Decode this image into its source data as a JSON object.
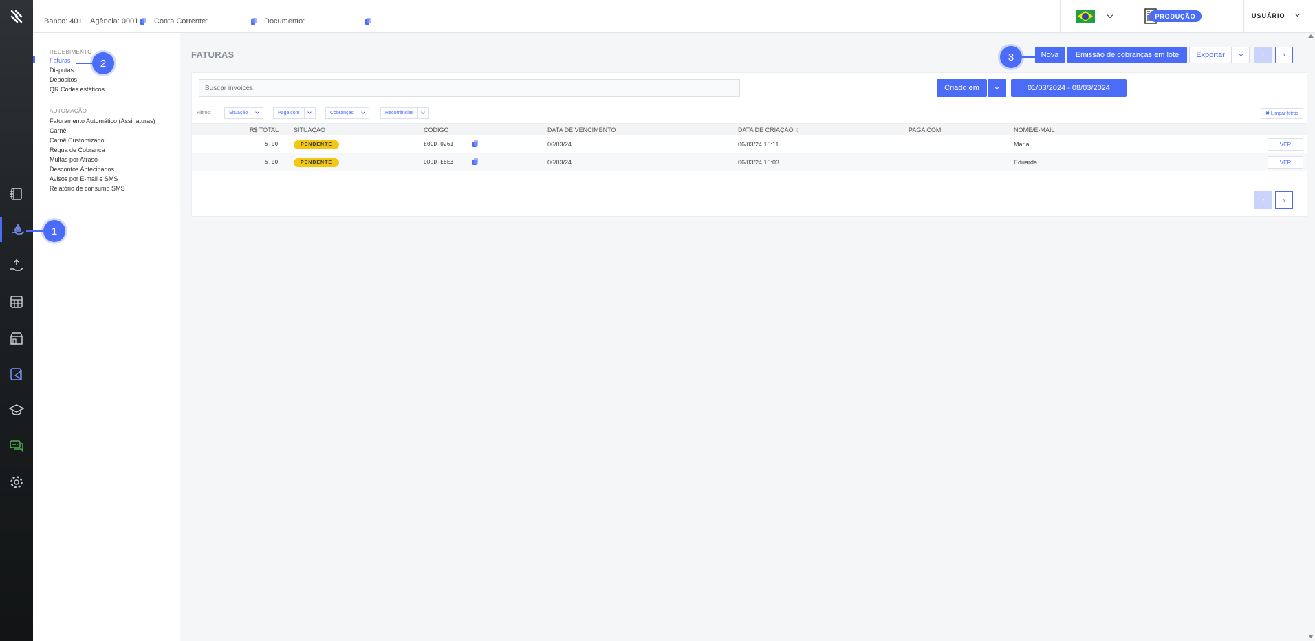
{
  "header": {
    "bank_label": "Banco: 401",
    "agency_label": "Agência: 0001",
    "account_label": "Conta Corrente:",
    "document_label": "Documento:",
    "environment_badge": "PRODUÇÃO",
    "user_label": "USUÁRIO",
    "flag_country": "brazil-flag-icon"
  },
  "rail": {
    "icons": [
      "logo-icon",
      "ledger-icon",
      "receive-money-icon",
      "send-money-icon",
      "calculator-icon",
      "store-icon",
      "pie-chart-icon",
      "graduation-cap-icon",
      "chat-icon",
      "gear-icon"
    ]
  },
  "sidebar": {
    "sections": [
      {
        "title": "RECEBIMENTO",
        "items": [
          "Faturas",
          "Disputas",
          "Depósitos",
          "QR Codes estáticos"
        ]
      },
      {
        "title": "AUTOMAÇÃO",
        "items": [
          "Faturamento Automático (Assinaturas)",
          "Carnê",
          "Carnê Customizado",
          "Régua de Cobrança",
          "Multas por Atraso",
          "Descontos Antecipados",
          "Avisos por E-mail e SMS",
          "Relatório de consumo SMS"
        ]
      }
    ],
    "active_item": "Faturas"
  },
  "main": {
    "title": "FATURAS",
    "buttons": {
      "new": "Nova",
      "batch": "Emissão de cobranças em lote",
      "export": "Exportar",
      "prev": "‹",
      "next": "›"
    },
    "search_placeholder": "Buscar invoices",
    "date_field": "Criado em",
    "date_range": "01/03/2024 - 08/03/2024",
    "filters_label": "Filtros:",
    "filters": [
      "Situação",
      "Paga com",
      "Cobranças",
      "Recorrências"
    ],
    "clear_filters": "✖ Limpar filtros",
    "table": {
      "headers": {
        "total": "R$ TOTAL",
        "status": "SITUAÇÃO",
        "code": "CÓDIGO",
        "due": "DATA DE VENCIMENTO",
        "created": "DATA DE CRIAÇÃO",
        "paid_with": "PAGA COM",
        "name": "NOME/E-MAIL"
      },
      "sort_icon": "sort-icon",
      "rows": [
        {
          "total": "5,00",
          "status": "PENDENTE",
          "code": "E0CD-0261",
          "due": "06/03/24",
          "created": "06/03/24 10:11",
          "paid_with": "",
          "name": "Maria",
          "action": "VER"
        },
        {
          "total": "5,00",
          "status": "PENDENTE",
          "code": "DDDD-E8E3",
          "due": "06/03/24",
          "created": "06/03/24 10:03",
          "paid_with": "",
          "name": "Eduarda",
          "action": "VER"
        }
      ]
    }
  },
  "steps": [
    "1",
    "2",
    "3"
  ],
  "colors": {
    "accent": "#4a6cf7",
    "pending_badge": "#f2c811",
    "rail_bg": "#1e2224"
  }
}
